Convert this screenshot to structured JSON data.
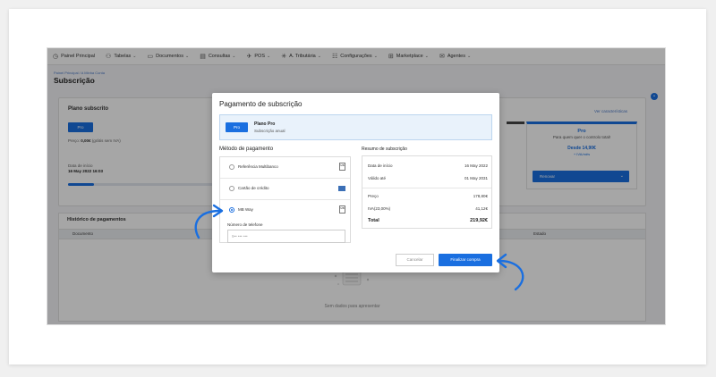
{
  "nav": [
    {
      "icon": "dashboard-icon",
      "glyph": "◷",
      "label": "Painel Principal",
      "chevron": false
    },
    {
      "icon": "users-icon",
      "glyph": "⚇",
      "label": "Tabelas",
      "chevron": true
    },
    {
      "icon": "document-icon",
      "glyph": "▭",
      "label": "Documentos",
      "chevron": true
    },
    {
      "icon": "chart-icon",
      "glyph": "▤",
      "label": "Consultas",
      "chevron": true
    },
    {
      "icon": "pos-icon",
      "glyph": "✈",
      "label": "POS",
      "chevron": true
    },
    {
      "icon": "tax-icon",
      "glyph": "✳",
      "label": "A. Tributária",
      "chevron": true
    },
    {
      "icon": "settings-icon",
      "glyph": "☷",
      "label": "Configurações",
      "chevron": true
    },
    {
      "icon": "marketplace-icon",
      "glyph": "⊞",
      "label": "Marketplace",
      "chevron": true
    },
    {
      "icon": "agents-icon",
      "glyph": "✉",
      "label": "Agentes",
      "chevron": true
    }
  ],
  "breadcrumb": "Painel Principal  /  A Minha Conta",
  "page_title": "Subscrição",
  "plan": {
    "title": "Plano subscrito",
    "badge": "Pro",
    "price_prefix": "Preço:",
    "price_value": "0,00€",
    "price_suffix": "(grátis sem IVA)",
    "start_label": "Data de início",
    "start_date": "16 May 2022 16:03",
    "progress": 0.06,
    "features_link": "Ver características"
  },
  "pro_card": {
    "name": "Pro",
    "desc": "Para quem quer o controlo total!",
    "from": "Desde 14,90€",
    "vat": "+ IVA/mês",
    "renew_label": "Renovar"
  },
  "history": {
    "title": "Histórico de pagamentos",
    "col_document": "Documento",
    "col_state": "Estado",
    "empty": "Sem dados para apresentar"
  },
  "modal": {
    "title": "Pagamento de subscrição",
    "selected_badge": "Pro",
    "selected_name": "Plano Pro",
    "selected_sub": "Subscrição anual",
    "payment_title": "Método de pagamento",
    "options": [
      {
        "label": "Referência Multibanco",
        "selected": false,
        "icon": "multibanco-icon",
        "icon_text": "MB"
      },
      {
        "label": "Cartão de crédito",
        "selected": false,
        "icon": "credit-card-icon",
        "icon_text": ""
      },
      {
        "label": "MB Way",
        "selected": true,
        "icon": "mbway-icon",
        "icon_text": "MB"
      }
    ],
    "phone_label": "Número de telefone",
    "phone_value": "9•• ••• •••",
    "summary_title": "Resumo de subscrição",
    "summary": {
      "start_label": "Data de início",
      "start_value": "16 May 2022",
      "valid_label": "Válido até",
      "valid_value": "01 May 2031",
      "price_label": "Preço",
      "price_value": "178,80€",
      "vat_label": "IVA(23,00%)",
      "vat_value": "41,12€",
      "total_label": "Total",
      "total_value": "219,92€"
    },
    "cancel_label": "Cancelar",
    "finish_label": "Finalizar compra"
  },
  "colors": {
    "accent": "#1a6fe0"
  }
}
